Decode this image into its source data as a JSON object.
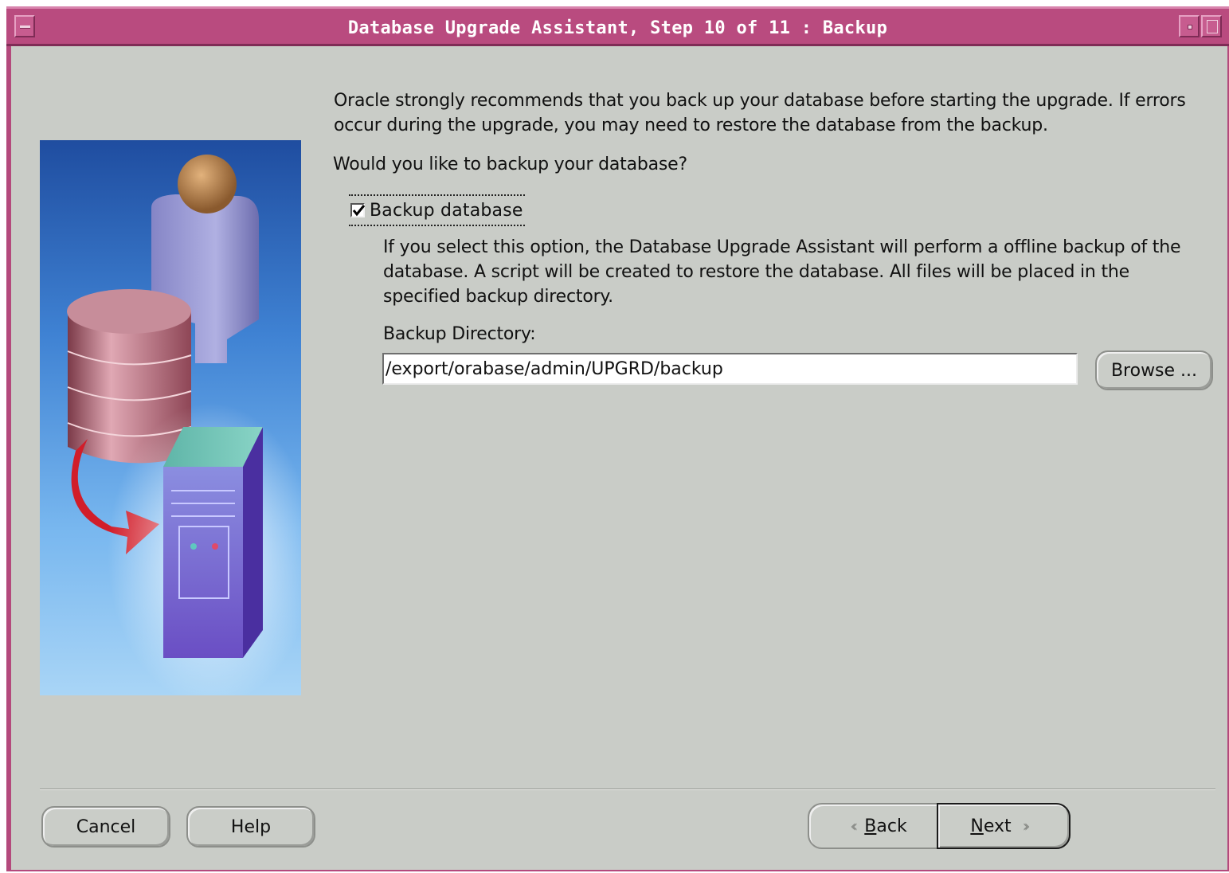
{
  "window": {
    "title": "Database Upgrade Assistant, Step 10 of 11 : Backup"
  },
  "content": {
    "intro": "Oracle strongly recommends that you back up your database before starting the upgrade. If errors occur during the upgrade, you may need to restore the database from the backup.",
    "question": "Would you like to backup your database?",
    "backup_checkbox": {
      "label": "Backup database",
      "checked": true
    },
    "description": "If you select this option, the Database Upgrade Assistant will perform a offline backup of the database. A script will be created to restore the database. All files will be placed in the specified backup directory.",
    "backup_directory_label": "Backup Directory:",
    "backup_directory_value": "/export/orabase/admin/UPGRD/backup",
    "browse_label": "Browse ..."
  },
  "footer": {
    "cancel_label": "Cancel",
    "help_label": "Help",
    "back_label": "Back",
    "next_label": "Next"
  },
  "colors": {
    "titlebar": "#b94b7f",
    "window_bg": "#c9ccc7",
    "illustration_bg": "#3f82d3"
  }
}
